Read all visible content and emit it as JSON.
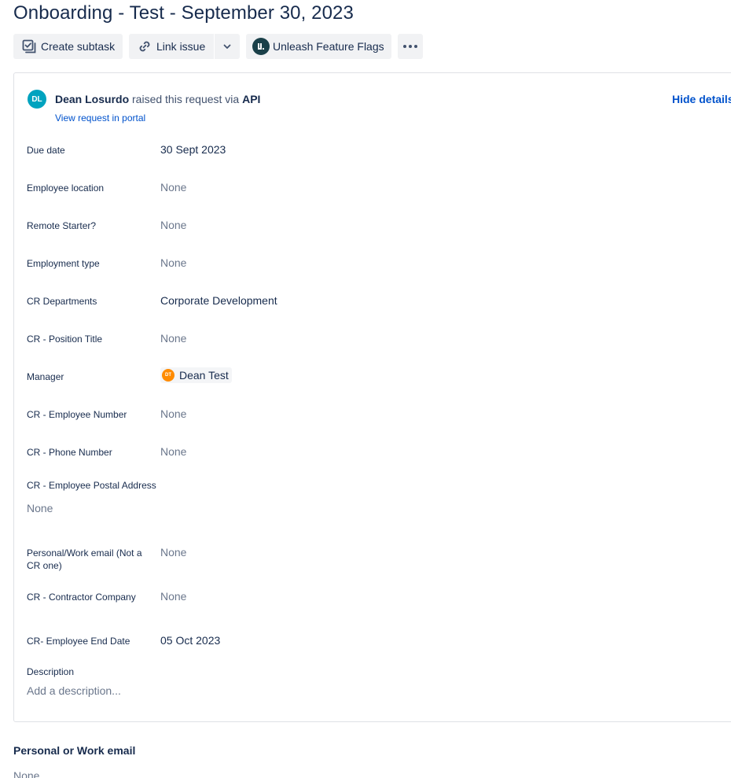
{
  "issue": {
    "title": "Onboarding - Test - September 30, 2023"
  },
  "toolbar": {
    "create_subtask_label": "Create subtask",
    "link_issue_label": "Link issue",
    "unleash_label": "Unleash Feature Flags"
  },
  "request": {
    "reporter_initials": "DL",
    "reporter_name": "Dean Losurdo",
    "raised_text": "raised this request via",
    "channel": "API",
    "portal_link": "View request in portal",
    "hide_details": "Hide details"
  },
  "fields": {
    "due_date": {
      "label": "Due date",
      "value": "30 Sept 2023"
    },
    "employee_location": {
      "label": "Employee location",
      "value": "None"
    },
    "remote_starter": {
      "label": "Remote Starter?",
      "value": "None"
    },
    "employment_type": {
      "label": "Employment type",
      "value": "None"
    },
    "cr_departments": {
      "label": "CR Departments",
      "value": "Corporate Development"
    },
    "cr_position_title": {
      "label": "CR - Position Title",
      "value": "None"
    },
    "manager": {
      "label": "Manager",
      "initials": "DT",
      "value": "Dean Test"
    },
    "cr_employee_number": {
      "label": "CR - Employee Number",
      "value": "None"
    },
    "cr_phone_number": {
      "label": "CR - Phone Number",
      "value": "None"
    },
    "cr_postal_address": {
      "label": "CR - Employee Postal Address",
      "value": "None"
    },
    "personal_work_email": {
      "label": "Personal/Work email (Not a CR one)",
      "value": "None"
    },
    "cr_contractor_company": {
      "label": "CR - Contractor Company",
      "value": "None"
    },
    "cr_end_date": {
      "label": "CR- Employee End Date",
      "value": "05 Oct 2023"
    },
    "description": {
      "label": "Description",
      "placeholder": "Add a description..."
    }
  },
  "section": {
    "title": "Personal or Work email",
    "value": "None"
  }
}
